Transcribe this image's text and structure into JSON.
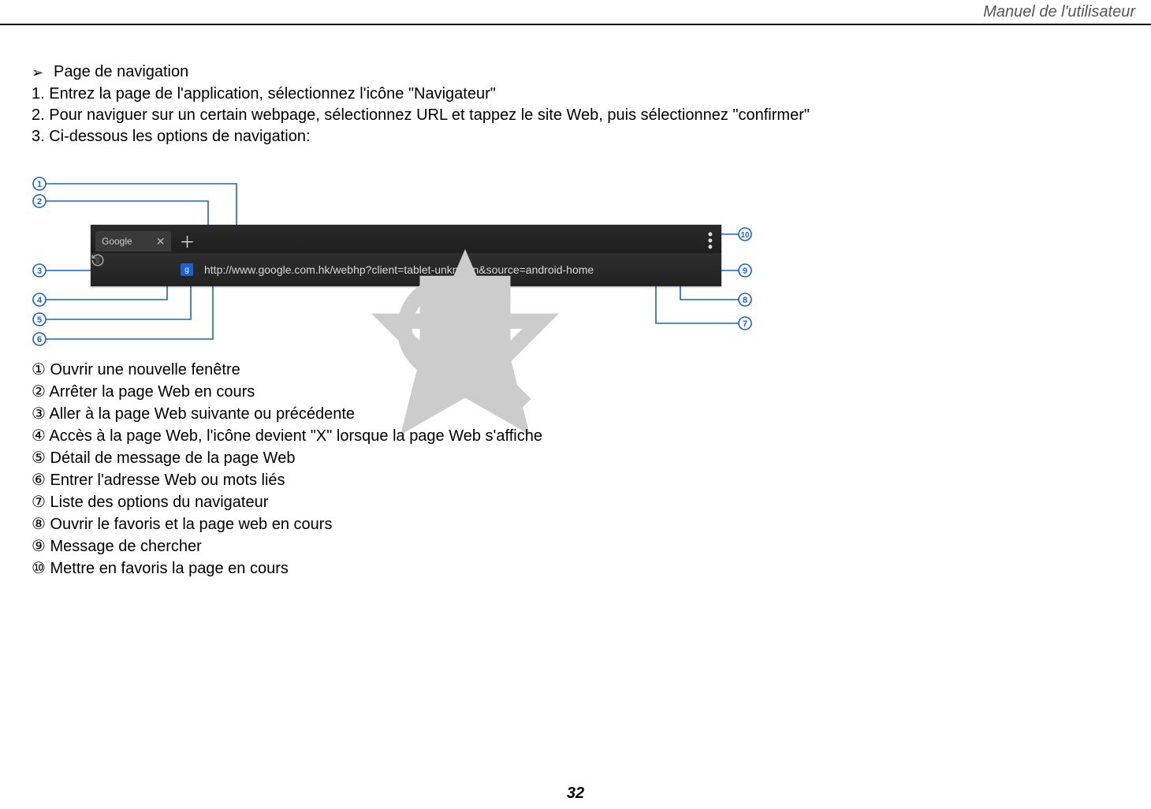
{
  "header": {
    "title": "Manuel de l'utilisateur"
  },
  "heading": "Page de navigation",
  "steps": {
    "s1": "1. Entrez la page de l'application, sélectionnez l'icône \"Navigateur\"",
    "s2": "2. Pour naviguer sur un certain webpage, sélectionnez URL et tappez le site Web, puis sélectionnez \"confirmer\"",
    "s3": "3. Ci-dessous les options de navigation:"
  },
  "browser": {
    "tab_label": "Google",
    "url": "http://www.google.com.hk/webhp?client=tablet-unknown&source=android-home"
  },
  "callouts": {
    "c1": "①",
    "c2": "②",
    "c3": "③",
    "c4": "④",
    "c5": "⑤",
    "c6": "⑥",
    "c7": "⑦",
    "c8": "⑧",
    "c9": "⑨",
    "c10": "⑩"
  },
  "badges": {
    "b1": "1",
    "b2": "2",
    "b3": "3",
    "b4": "4",
    "b5": "5",
    "b6": "6",
    "b7": "7",
    "b8": "8",
    "b9": "9",
    "b10": "10"
  },
  "legend": {
    "i1": "Ouvrir une nouvelle fenêtre",
    "i2": "Arrêter la page Web en cours",
    "i3": "Aller à la page Web suivante ou précédente",
    "i4": "Accès à la page Web, l'icône devient \"X\" lorsque la page Web s'affiche",
    "i5": "Détail de message de la page Web",
    "i6": "Entrer l'adresse Web ou mots liés",
    "i7": "Liste des options du navigateur",
    "i8": "Ouvrir le favoris et la page web en cours",
    "i9": "Message de chercher",
    "i10": "Mettre en favoris la page en cours"
  },
  "page_number": "32"
}
